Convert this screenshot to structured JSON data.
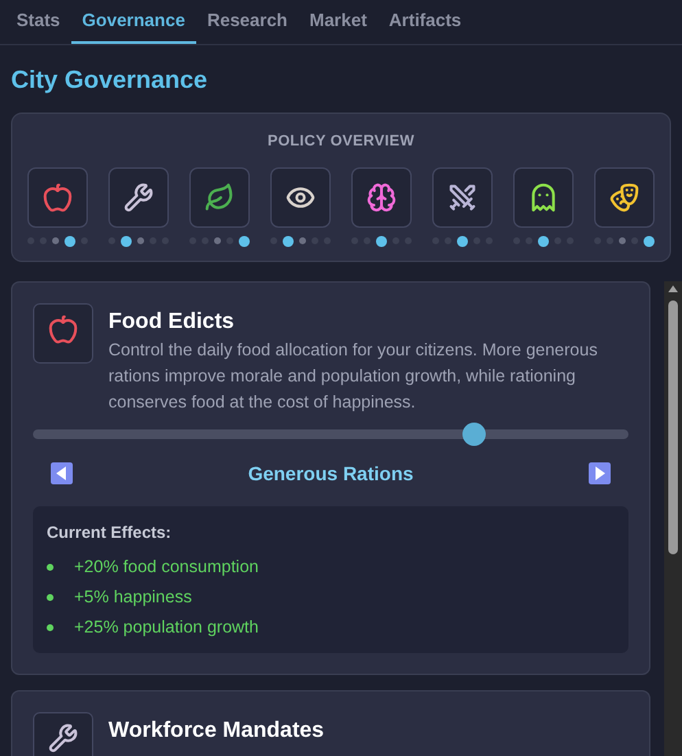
{
  "tabs": [
    {
      "label": "Stats",
      "selected": false
    },
    {
      "label": "Governance",
      "selected": true
    },
    {
      "label": "Research",
      "selected": false
    },
    {
      "label": "Market",
      "selected": false
    },
    {
      "label": "Artifacts",
      "selected": false
    }
  ],
  "page_title": "City Governance",
  "policy_overview": {
    "title": "POLICY OVERVIEW",
    "policies": [
      {
        "dots": [
          {
            "selected": false
          },
          {
            "selected": false
          },
          {
            "selected": false
          },
          {
            "selected": true
          },
          {
            "selected": false
          }
        ]
      },
      {
        "dots": [
          {
            "selected": false
          },
          {
            "selected": true
          },
          {
            "selected": false
          },
          {
            "selected": false
          },
          {
            "selected": false
          }
        ]
      },
      {
        "dots": [
          {
            "selected": false
          },
          {
            "selected": false
          },
          {
            "selected": false
          },
          {
            "selected": false
          },
          {
            "selected": true
          }
        ]
      },
      {
        "dots": [
          {
            "selected": false
          },
          {
            "selected": true
          },
          {
            "selected": false
          },
          {
            "selected": false
          },
          {
            "selected": false
          }
        ]
      },
      {
        "dots": [
          {
            "selected": false
          },
          {
            "selected": false
          },
          {
            "selected": true
          },
          {
            "selected": false
          },
          {
            "selected": false
          }
        ]
      },
      {
        "dots": [
          {
            "selected": false
          },
          {
            "selected": false
          },
          {
            "selected": true
          },
          {
            "selected": false
          },
          {
            "selected": false
          }
        ]
      },
      {
        "dots": [
          {
            "selected": false
          },
          {
            "selected": false
          },
          {
            "selected": true
          },
          {
            "selected": false
          },
          {
            "selected": false
          }
        ]
      },
      {
        "dots": [
          {
            "selected": false
          },
          {
            "selected": false
          },
          {
            "selected": false
          },
          {
            "selected": false
          },
          {
            "selected": true
          }
        ]
      }
    ]
  },
  "policy_cards": [
    {
      "title": "Food Edicts",
      "description": "Control the daily food allocation for your citizens. More generous rations improve morale and population growth, while rationing conserves food at the cost of happiness.",
      "level": 0.75,
      "setting": "Generous Rations",
      "effects_title": "Current Effects:",
      "effects": [
        "+20% food consumption",
        "+5% happiness",
        "+25% population growth"
      ]
    },
    {
      "title": "Workforce Mandates"
    }
  ]
}
